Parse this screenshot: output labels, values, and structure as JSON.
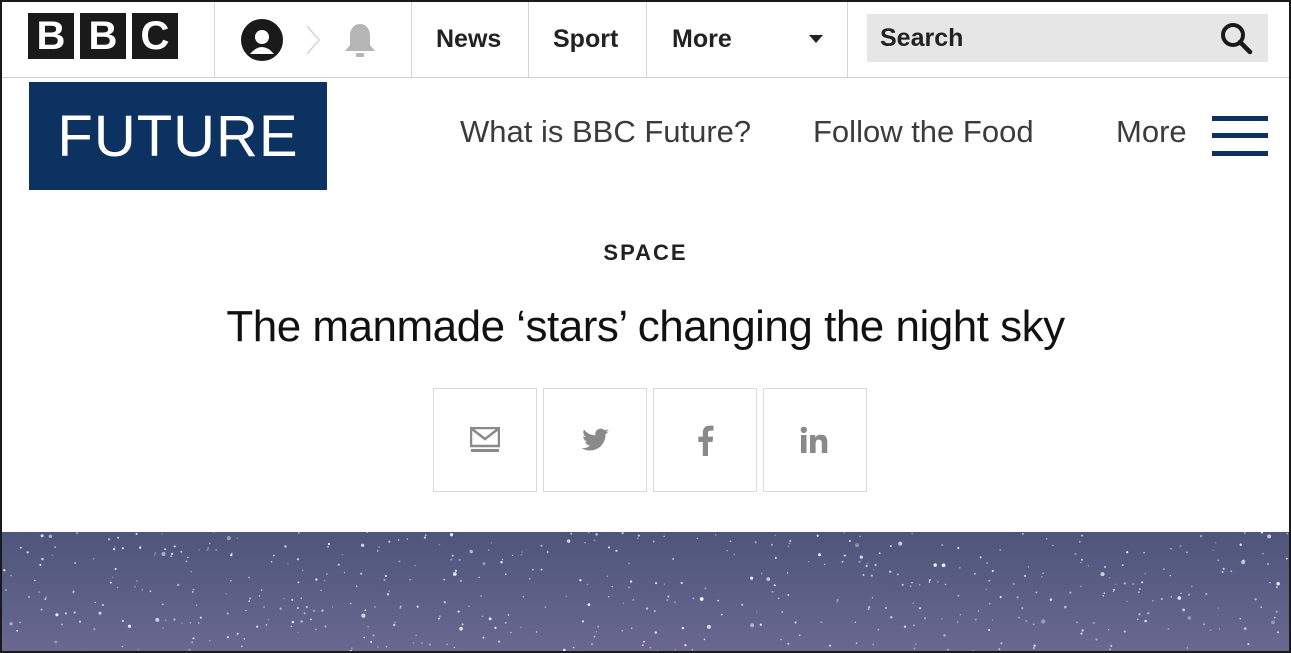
{
  "global_nav": {
    "logo_letters": [
      "B",
      "B",
      "C"
    ],
    "links": [
      "News",
      "Sport",
      "More"
    ],
    "search_placeholder": "Search",
    "icons": {
      "account": "account-icon",
      "notifications": "bell-icon",
      "more": "caret-down-icon",
      "search": "search-icon"
    }
  },
  "section_nav": {
    "brand": "FUTURE",
    "brand_color": "#0b3261",
    "links": [
      "What is BBC Future?",
      "Follow the Food"
    ],
    "more_label": "More",
    "menu_icon": "hamburger-icon"
  },
  "article": {
    "kicker": "SPACE",
    "headline": "The manmade ‘stars’ changing the night sky",
    "share_buttons": [
      "email-icon",
      "twitter-icon",
      "facebook-icon",
      "linkedin-icon"
    ]
  },
  "hero_image": {
    "description_color": "#555a80",
    "icon": "starry-sky-image"
  }
}
